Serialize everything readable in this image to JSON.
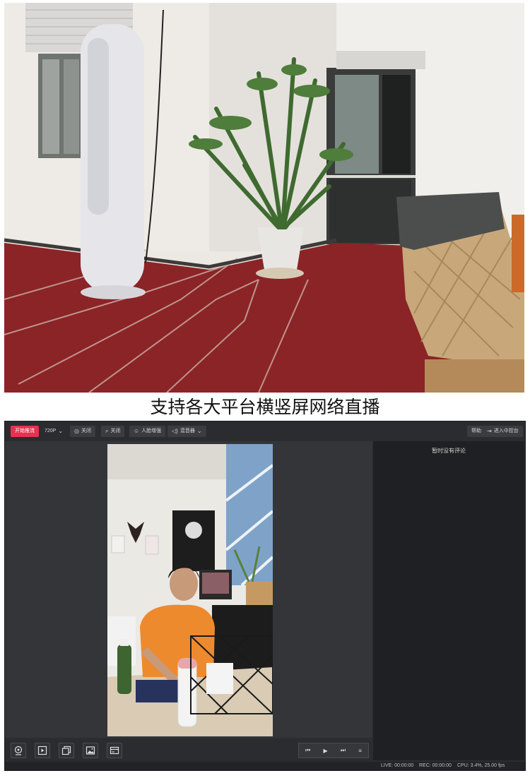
{
  "caption": "支持各大平台横竖屏网络直播",
  "toolbar": {
    "start_stream": "开始推流",
    "resolution": "720P",
    "camera_off": "关闭",
    "search_off": "关闭",
    "face_enhance": "人脸增强",
    "mixer": "混音器",
    "help": "帮助",
    "enter_console": "进入中控台"
  },
  "comments": {
    "empty_text": "暂时没有评论"
  },
  "status": {
    "live": "LIVE: 00:00:00",
    "rec": "REC: 00:00:00",
    "cpu": "CPU: 3.4%, 25.00 fps"
  },
  "icons": [
    "chevron-down-icon",
    "camera-icon",
    "search-icon",
    "face-icon",
    "speaker-icon",
    "exit-icon",
    "webcam-icon",
    "play-square-icon",
    "copy-icon",
    "image-icon",
    "screen-icon",
    "skip-back-icon",
    "play-icon",
    "skip-forward-icon",
    "menu-icon"
  ],
  "colors": {
    "accent": "#e8304f",
    "panel": "#1f2023",
    "toolbar": "#2a2c2f"
  }
}
